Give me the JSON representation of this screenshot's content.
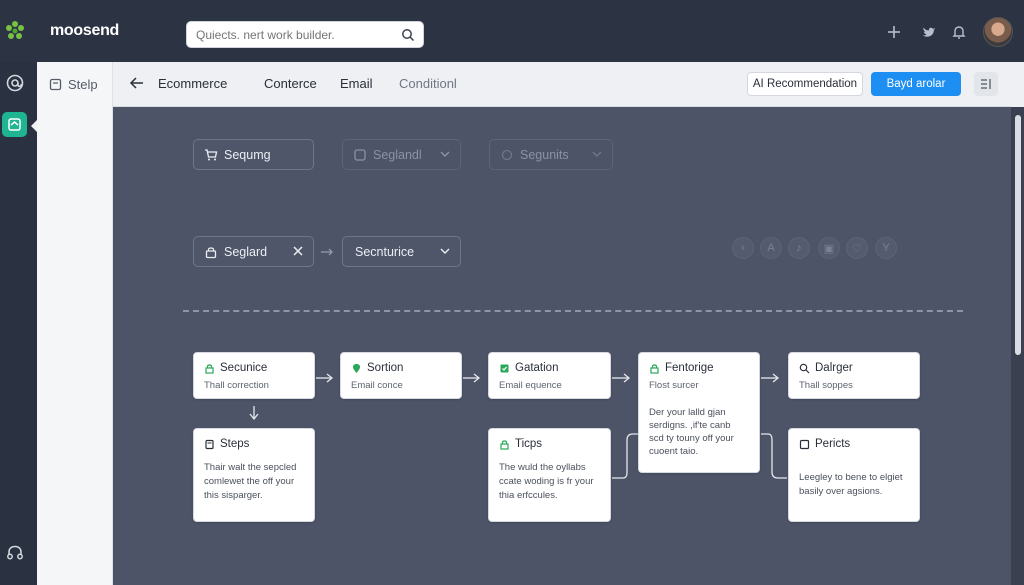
{
  "app": {
    "name": "moosend"
  },
  "search": {
    "placeholder": "Quiects. nert work builder."
  },
  "topbar": {
    "icons": [
      "plus-icon",
      "twitter-icon",
      "bell-icon"
    ],
    "avatar": "user-avatar"
  },
  "sidepanel": {
    "label": "Stelp"
  },
  "header": {
    "title": "Ecommerce",
    "tabs": [
      {
        "label": "Conterce"
      },
      {
        "label": "Email"
      },
      {
        "label": "Conditionl"
      }
    ],
    "ai_button": "AI Recommendation",
    "primary_button": "Bayd arolar"
  },
  "filters": {
    "row1": [
      {
        "label": "Sequmg"
      },
      {
        "label": "Seglandl"
      },
      {
        "label": "Segunits"
      }
    ],
    "row2": [
      {
        "label": "Seglard"
      },
      {
        "label": "Secnturice"
      }
    ],
    "tool_icons": [
      "chevron-left-icon",
      "text-icon",
      "music-icon",
      "image-icon",
      "heart-icon",
      "filter-icon"
    ]
  },
  "cards": {
    "c1": {
      "title": "Secunice",
      "subtitle": "Thall correction"
    },
    "c2": {
      "title": "Sortion",
      "subtitle": "Email conce"
    },
    "c3": {
      "title": "Gatation",
      "subtitle": "Email equence"
    },
    "c4": {
      "title": "Fentorige",
      "subtitle": "Flost surcer",
      "body": [
        "Der your lalld gjan",
        "serdigns. ,if'te canb",
        "scd ty touny off your",
        "cuoent taio."
      ]
    },
    "c5": {
      "title": "Dalrger",
      "subtitle": "Thall soppes"
    },
    "c6": {
      "title": "Steps",
      "body": [
        "Thair walt the sepcled",
        "comlewet the off your",
        "this sisparger."
      ]
    },
    "c7": {
      "title": "Ticps",
      "body": [
        "The wuld the oyllabs",
        "ccate woding is fr your",
        "thia erfccules."
      ]
    },
    "c8": {
      "title": "Pericts",
      "body": [
        "Leegley to bene to elgiet",
        "basily over agsions."
      ]
    }
  },
  "colors": {
    "accent": "#1fb592",
    "primary": "#1e8ff2",
    "canvas": "#4d5468",
    "topbar": "#2c3444"
  }
}
